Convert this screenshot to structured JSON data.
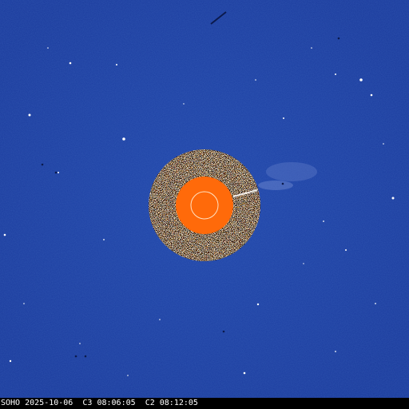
{
  "image": {
    "kind": "SOHO LASCO C2/C3 composite coronagraph frame",
    "colors": {
      "background": "#1c3fa3",
      "background_dark": "#16338c",
      "occulter": "#ff6a0a",
      "sun_limb": "#ffe2c4",
      "c2_ring_dark": "#3b2414",
      "c2_ring_light": "#f3e6d6",
      "star": "#ffffff"
    },
    "icons": [
      "occulting-disk",
      "sun-limb-circle"
    ]
  },
  "caption": {
    "observatory": "SOHO",
    "date": "2025-10-06",
    "c3_label": "C3",
    "c3_time": "08:06:05",
    "c2_label": "C2",
    "c2_time": "08:12:05"
  }
}
